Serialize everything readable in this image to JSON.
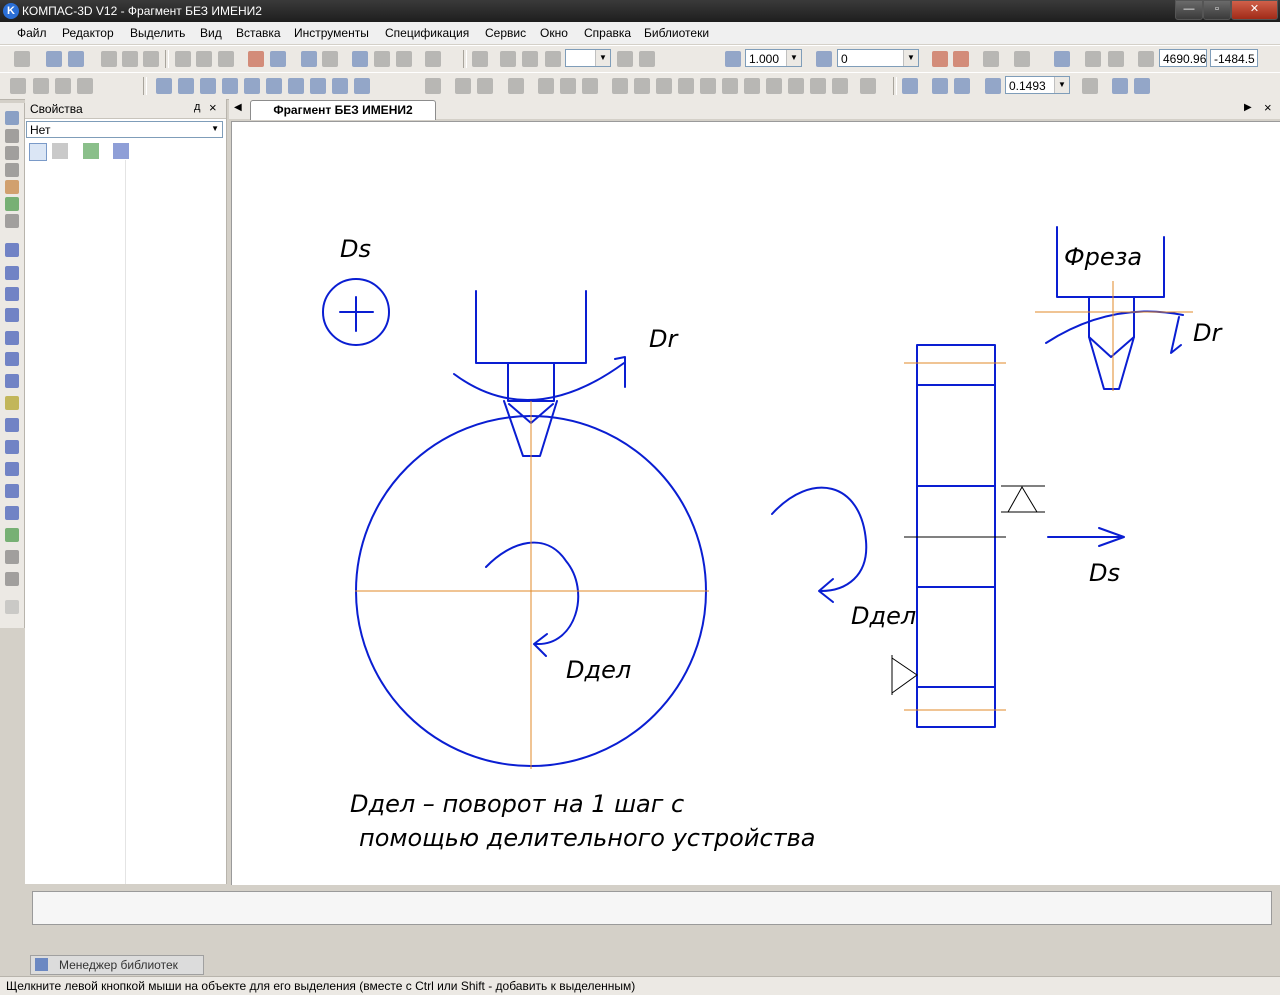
{
  "window": {
    "title": "КОМПАС-3D V12 - Фрагмент БЕЗ ИМЕНИ2",
    "logo_letter": "K"
  },
  "menu": [
    "Файл",
    "Редактор",
    "Выделить",
    "Вид",
    "Вставка",
    "Инструменты",
    "Спецификация",
    "Сервис",
    "Окно",
    "Справка",
    "Библиотеки"
  ],
  "toolbar": {
    "scale_value": "1.000",
    "layer_value": "0",
    "coord_x": "4690.96",
    "coord_y": "-1484.5",
    "zoom_value": "0.1493"
  },
  "properties_panel": {
    "title": "Свойства",
    "pin_glyph": "д",
    "close_glyph": "×",
    "select_value": "Нет"
  },
  "document_tab": {
    "label": "Фрагмент БЕЗ ИМЕНИ2"
  },
  "drawing": {
    "label_ds_top": "Ds",
    "label_dr_main": "Dr",
    "label_ddel_circle": "Dдел",
    "label_freza": "Фреза",
    "label_dr_small": "Dr",
    "label_ddel_mid": "Dдел",
    "label_ds_right": "Ds",
    "note_line1": "Dдел – поворот на 1 шаг с",
    "note_line2": "помощью делительного устройства",
    "line_color": "#0a1ed2",
    "axis_color": "#e08a2a"
  },
  "library_tab": {
    "label": "Менеджер библиотек"
  },
  "status_bar": {
    "text": "Щелкните левой кнопкой мыши на объекте для его выделения (вместе с Ctrl или Shift - добавить к выделенным)"
  }
}
